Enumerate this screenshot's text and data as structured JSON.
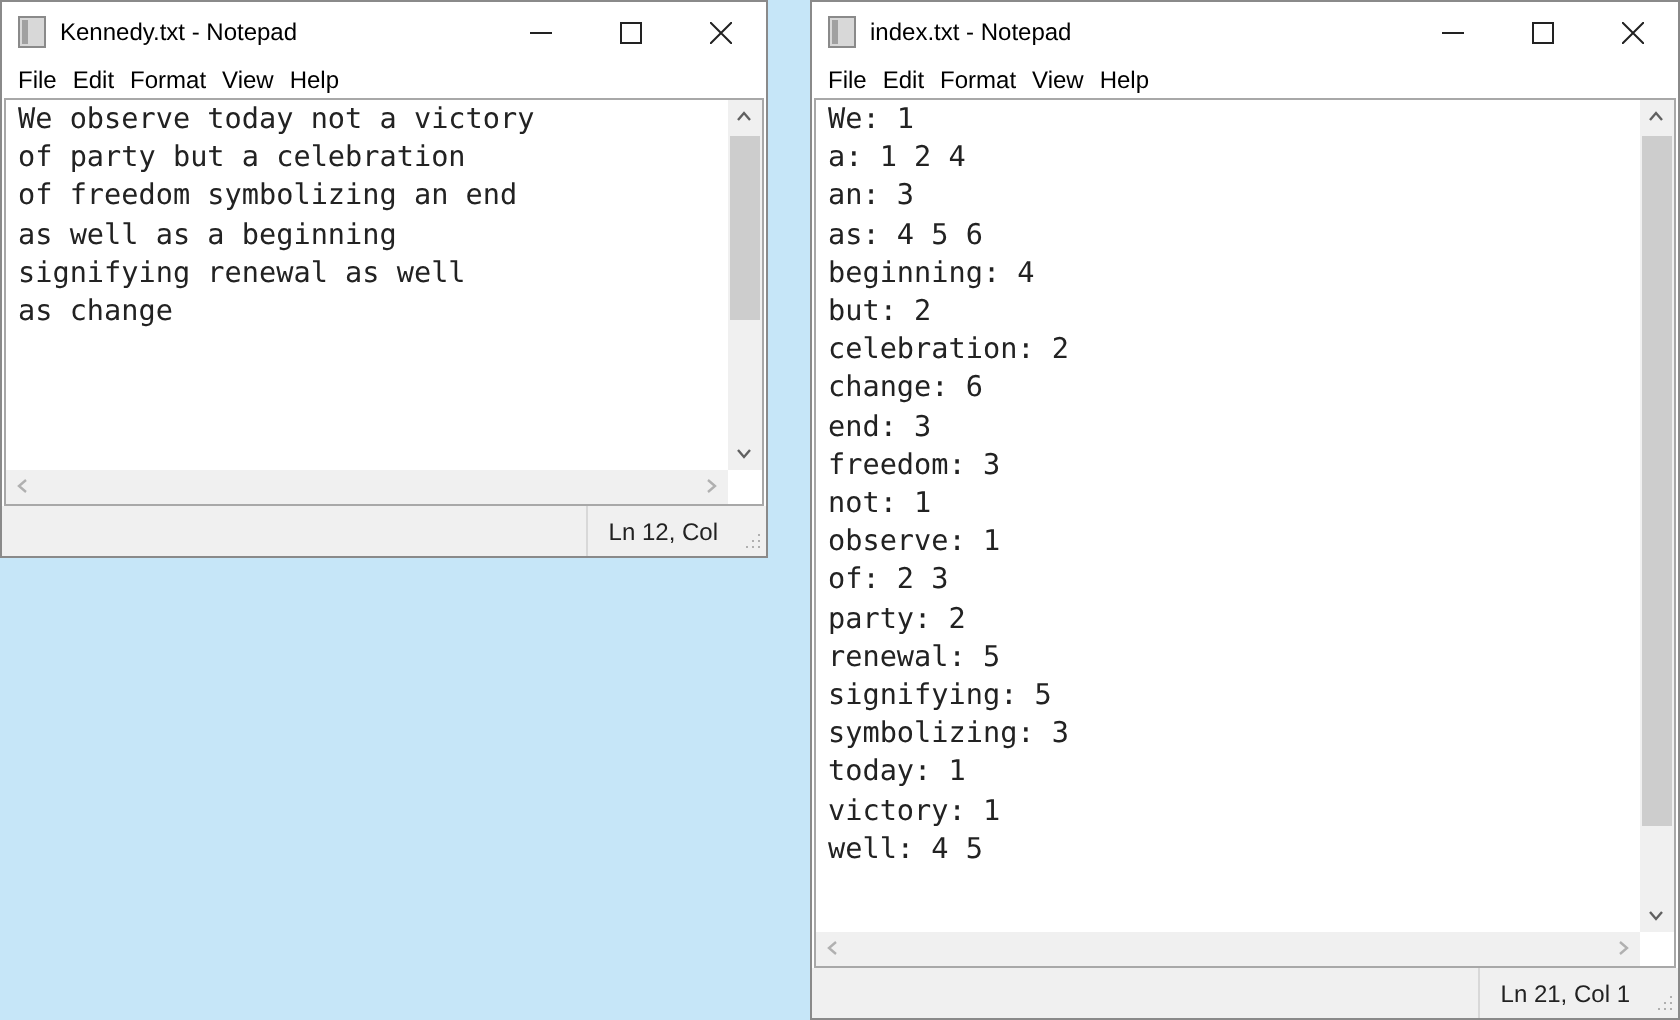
{
  "windows": [
    {
      "title": "Kennedy.txt - Notepad",
      "menu": [
        "File",
        "Edit",
        "Format",
        "View",
        "Help"
      ],
      "lines": [
        "We observe today not a victory",
        "of party but a celebration",
        "of freedom symbolizing an end",
        "as well as a beginning",
        "signifying renewal as well",
        "as change"
      ],
      "status": "Ln 12, Col"
    },
    {
      "title": "index.txt - Notepad",
      "menu": [
        "File",
        "Edit",
        "Format",
        "View",
        "Help"
      ],
      "lines": [
        "We: 1",
        "a: 1 2 4",
        "an: 3",
        "as: 4 5 6",
        "beginning: 4",
        "but: 2",
        "celebration: 2",
        "change: 6",
        "end: 3",
        "freedom: 3",
        "not: 1",
        "observe: 1",
        "of: 2 3",
        "party: 2",
        "renewal: 5",
        "signifying: 5",
        "symbolizing: 3",
        "today: 1",
        "victory: 1",
        "well: 4 5"
      ],
      "status": "Ln 21, Col 1"
    }
  ]
}
